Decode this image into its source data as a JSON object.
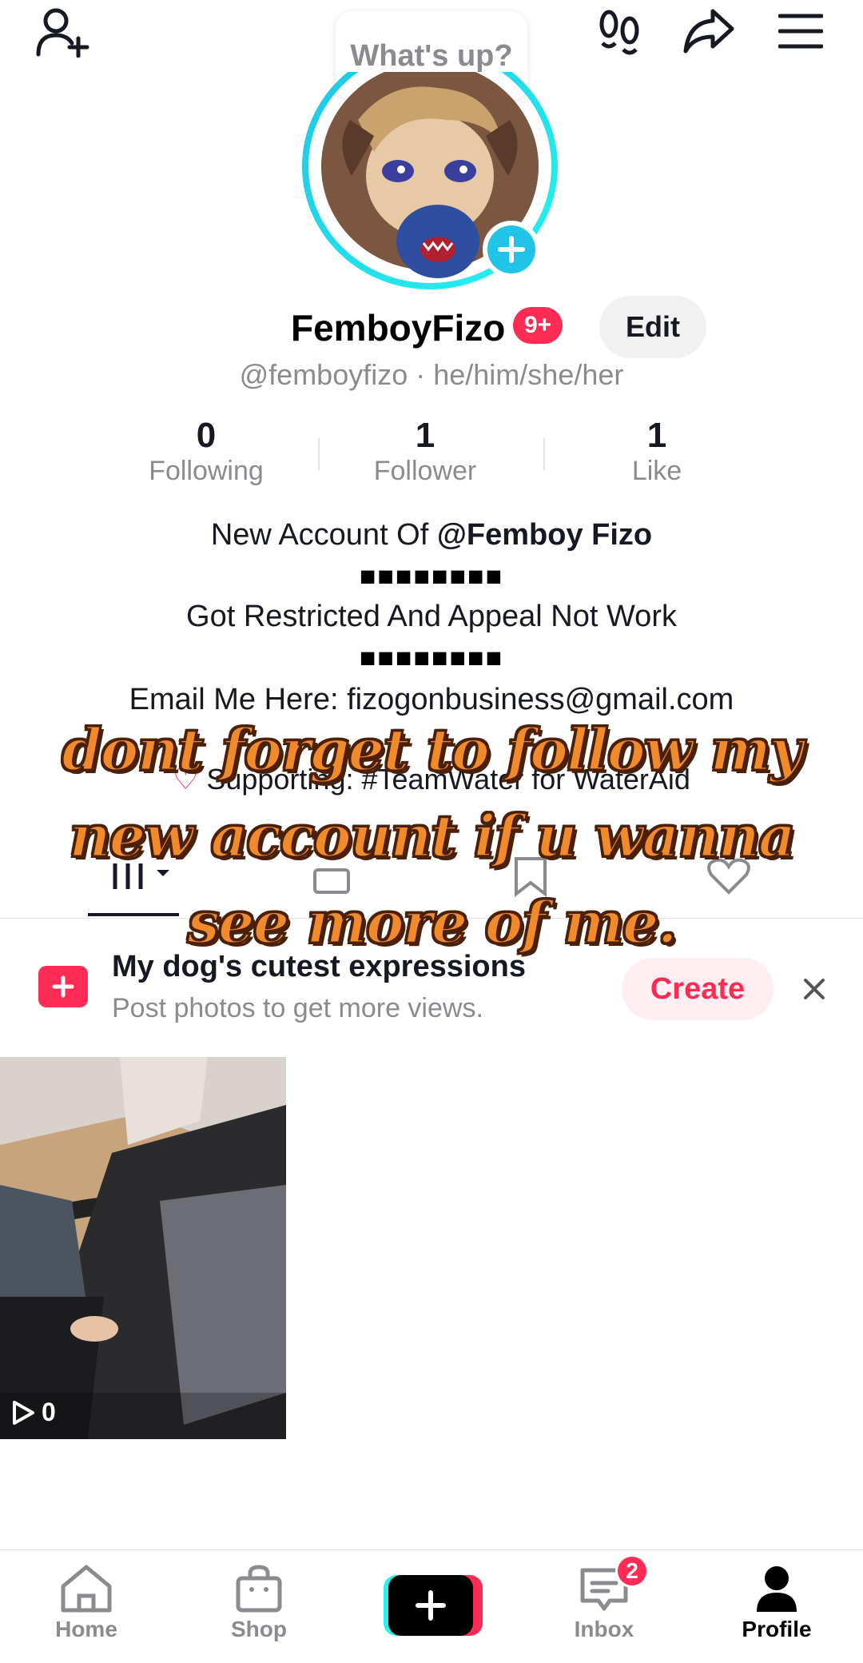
{
  "header": {
    "status_bubble": "What's up?"
  },
  "profile": {
    "display_name": "FemboyFizo",
    "notification_badge": "9+",
    "edit_label": "Edit",
    "handle_line": "@femboyfizo · he/him/she/her"
  },
  "stats": [
    {
      "value": "0",
      "label": "Following"
    },
    {
      "value": "1",
      "label": "Follower"
    },
    {
      "value": "1",
      "label": "Like"
    }
  ],
  "bio": {
    "line1_prefix": "New Account Of ",
    "line1_mention": "@Femboy Fizo",
    "separator1": "■■■■■■■■",
    "line2": "Got Restricted And Appeal Not Work",
    "separator2": "■■■■■■■■",
    "line3": "Email Me Here: fizogonbusiness@gmail.com",
    "supporting": "Supporting: #TeamWater for WaterAid"
  },
  "overlay": {
    "line1": "dont forget to follow my",
    "line2": "new account if u wanna",
    "line3": "see more of me."
  },
  "prompt_card": {
    "title": "My dog's cutest expressions",
    "subtitle": "Post photos to get more views.",
    "create_label": "Create"
  },
  "videos": [
    {
      "views": "0"
    }
  ],
  "bottom_nav": {
    "home": "Home",
    "shop": "Shop",
    "inbox": "Inbox",
    "inbox_badge": "2",
    "profile": "Profile"
  },
  "colors": {
    "accent": "#fe2c55",
    "ring": "#25f4ee",
    "plus_badge": "#20c4e8"
  }
}
